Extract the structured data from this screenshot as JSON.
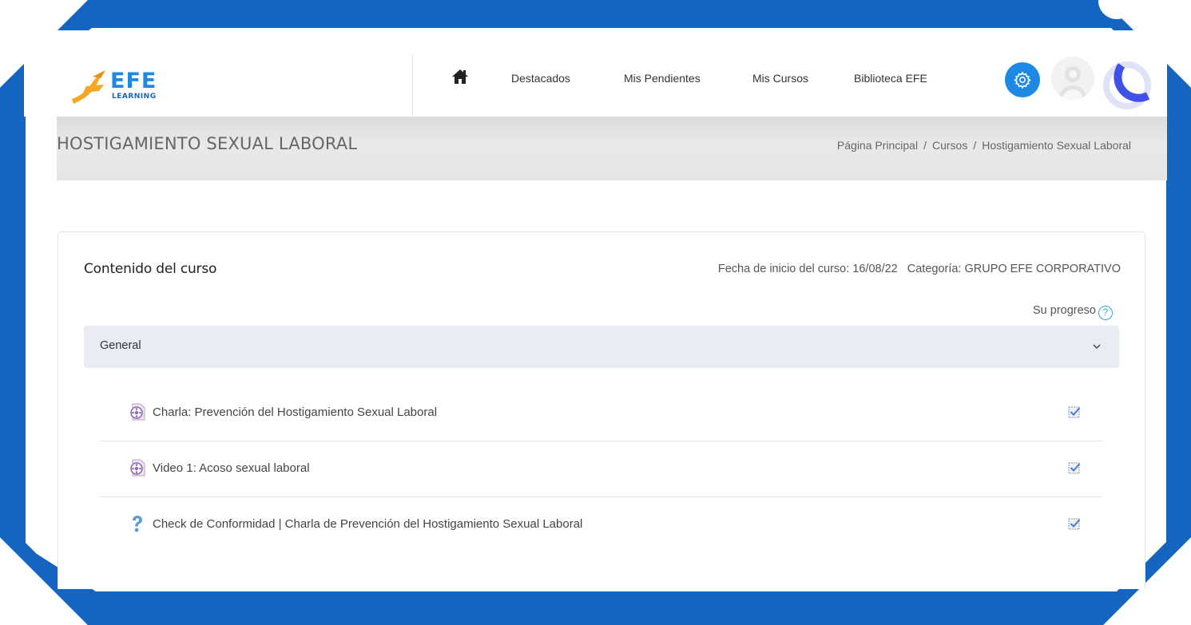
{
  "theme": {
    "frame_color": "#1565c0",
    "accent": "#1e88e5",
    "logo_orange": "#f5a623",
    "title_band": "#e6e6e6",
    "section_bg": "#e9ecf3",
    "progress_ring": "#3f51e8"
  },
  "logo": {
    "brand": "EFE",
    "sub": "LEARNING"
  },
  "nav": {
    "home_icon": "home-icon",
    "items": [
      "Destacados",
      "Mis Pendientes",
      "Mis Cursos",
      "Biblioteca EFE"
    ]
  },
  "header_icons": {
    "settings": "gear-icon",
    "user": "avatar-icon"
  },
  "page": {
    "title": "HOSTIGAMIENTO SEXUAL LABORAL",
    "breadcrumb": [
      "Página Principal",
      "Cursos",
      "Hostigamiento Sexual Laboral"
    ],
    "breadcrumb_separator": "/"
  },
  "course": {
    "content_heading": "Contenido del curso",
    "start_date": "Fecha de inicio del curso: 16/08/22",
    "category": "Categoría: GRUPO EFE CORPORATIVO",
    "progress_label": "Su progreso",
    "help_glyph": "?"
  },
  "section": {
    "name": "General",
    "expanded": true,
    "activities": [
      {
        "name": "Charla: Prevención del Hostigamiento Sexual Laboral",
        "icon": "video-icon",
        "completed": true
      },
      {
        "name": "Video 1: Acoso sexual laboral",
        "icon": "video-icon",
        "completed": true
      },
      {
        "name": "Check de Conformidad | Charla de Prevención del Hostigamiento Sexual Laboral",
        "icon": "question-icon",
        "completed": true
      }
    ]
  }
}
